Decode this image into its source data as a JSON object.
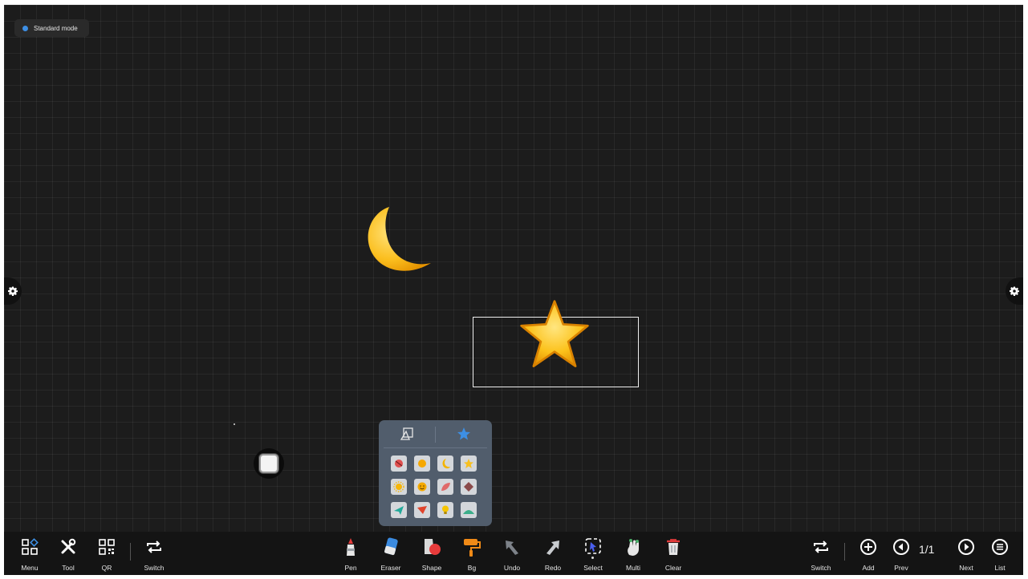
{
  "mode": {
    "label": "Standard mode"
  },
  "colors": {
    "board": "#1c1c1c",
    "accent": "#3d8fe4",
    "panel": "#515d6c",
    "toolbar": "#141414"
  },
  "canvas_items": [
    {
      "name": "moon-emoji-icon"
    },
    {
      "name": "star-emoji-icon",
      "selected": true
    }
  ],
  "shape_panel": {
    "tabs": [
      {
        "icon": "shape-outline-icon",
        "active": false
      },
      {
        "icon": "star-icon",
        "active": true
      }
    ],
    "shapes": [
      "ball-shape",
      "sun-shape",
      "moon-shape",
      "star-shape",
      "bright-sun-shape",
      "smiley-shape",
      "leaf-shape",
      "diamond-shape",
      "paper-plane-shape",
      "wedge-shape",
      "lightbulb-shape",
      "hill-shape"
    ]
  },
  "toolbar": {
    "left": [
      {
        "label": "Menu",
        "icon": "menu-grid-icon"
      },
      {
        "label": "Tool",
        "icon": "tools-icon"
      },
      {
        "label": "QR",
        "icon": "qr-code-icon"
      },
      {
        "label": "Switch",
        "icon": "switch-icon"
      }
    ],
    "center": [
      {
        "label": "Pen",
        "icon": "pen-icon"
      },
      {
        "label": "Eraser",
        "icon": "eraser-icon"
      },
      {
        "label": "Shape",
        "icon": "shape-icon"
      },
      {
        "label": "Bg",
        "icon": "paint-roller-icon"
      },
      {
        "label": "Undo",
        "icon": "undo-icon"
      },
      {
        "label": "Redo",
        "icon": "redo-icon"
      },
      {
        "label": "Select",
        "icon": "select-icon",
        "active": true
      },
      {
        "label": "Multi",
        "icon": "multi-touch-icon"
      },
      {
        "label": "Clear",
        "icon": "trash-icon"
      }
    ],
    "right": [
      {
        "label": "Switch",
        "icon": "switch-icon"
      },
      {
        "label": "Add",
        "icon": "add-page-icon"
      },
      {
        "label": "Prev",
        "icon": "prev-page-icon"
      },
      {
        "label": "Next",
        "icon": "next-page-icon"
      },
      {
        "label": "List",
        "icon": "list-icon"
      }
    ],
    "page_indicator": "1/1"
  }
}
